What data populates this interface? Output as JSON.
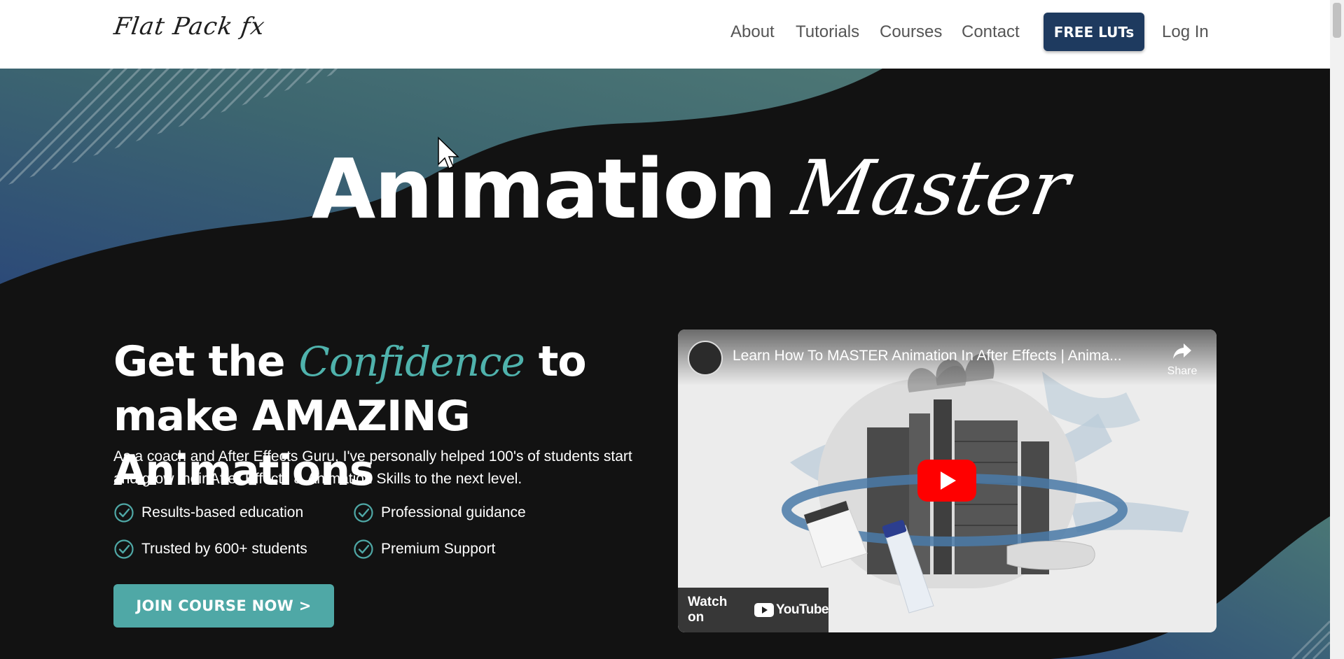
{
  "header": {
    "logo_text": "Flat Pack fx",
    "nav": [
      {
        "label": "About"
      },
      {
        "label": "Tutorials"
      },
      {
        "label": "Courses"
      },
      {
        "label": "Contact"
      }
    ],
    "cta_label": "FREE LUTs",
    "login_label": "Log In"
  },
  "hero": {
    "title_main": "Animation",
    "title_script": "Master",
    "headline_before": "Get the",
    "headline_highlight": "Confidence",
    "headline_after": "to make AMAZING Animations",
    "description": "As a coach and After Effects Guru, I've personally helped 100's of students start and grow their After Effects & Animation Skills to the next level.",
    "features": [
      "Results-based education",
      "Professional guidance",
      "Trusted by 600+ students",
      "Premium Support"
    ],
    "join_label": "JOIN COURSE NOW >"
  },
  "video": {
    "title": "Learn How To MASTER Animation In After Effects | Anima...",
    "share_label": "Share",
    "watch_label": "Watch on",
    "youtube_label": "YouTube"
  },
  "colors": {
    "accent_teal": "#4fa8a6",
    "navy_button": "#1e3a5f",
    "hero_background": "#121212"
  }
}
